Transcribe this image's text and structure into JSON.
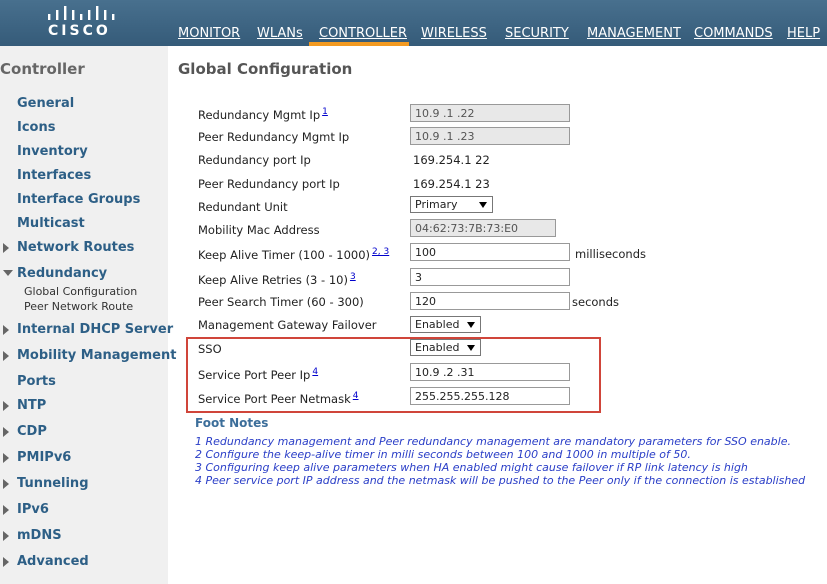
{
  "brand": {
    "logo_text": "CISCO"
  },
  "nav": {
    "items": [
      "MONITOR",
      "WLANs",
      "CONTROLLER",
      "WIRELESS",
      "SECURITY",
      "MANAGEMENT",
      "COMMANDS",
      "HELP"
    ],
    "active": "CONTROLLER",
    "accent_color": "#f39a21"
  },
  "sidebar": {
    "title": "Controller",
    "items": [
      {
        "label": "General",
        "arrow": "none"
      },
      {
        "label": "Icons",
        "arrow": "none"
      },
      {
        "label": "Inventory",
        "arrow": "none"
      },
      {
        "label": "Interfaces",
        "arrow": "none"
      },
      {
        "label": "Interface Groups",
        "arrow": "none"
      },
      {
        "label": "Multicast",
        "arrow": "none"
      },
      {
        "label": "Network Routes",
        "arrow": "right"
      },
      {
        "label": "Redundancy",
        "arrow": "down"
      },
      {
        "label": "Internal DHCP Server",
        "arrow": "right"
      },
      {
        "label": "Mobility Management",
        "arrow": "right"
      },
      {
        "label": "Ports",
        "arrow": "none"
      },
      {
        "label": "NTP",
        "arrow": "right"
      },
      {
        "label": "CDP",
        "arrow": "right"
      },
      {
        "label": "PMIPv6",
        "arrow": "right"
      },
      {
        "label": "Tunneling",
        "arrow": "right"
      },
      {
        "label": "IPv6",
        "arrow": "right"
      },
      {
        "label": "mDNS",
        "arrow": "right"
      },
      {
        "label": "Advanced",
        "arrow": "right"
      }
    ],
    "redundancy_sub": [
      "Global Configuration",
      "Peer Network Route"
    ]
  },
  "page": {
    "title": "Global Configuration",
    "rows": [
      {
        "label": "Redundancy Mgmt Ip",
        "note": "1",
        "value": "10.9  .1  .22",
        "kind": "disabled"
      },
      {
        "label": "Peer Redundancy Mgmt Ip",
        "note": "",
        "value": "10.9  .1  .23",
        "kind": "disabled"
      },
      {
        "label": "Redundancy port Ip",
        "note": "",
        "value": "169.254.1   22",
        "kind": "plain"
      },
      {
        "label": "Peer Redundancy port Ip",
        "note": "",
        "value": "169.254.1   23",
        "kind": "plain"
      },
      {
        "label": "Redundant Unit",
        "note": "",
        "value": "Primary",
        "kind": "select"
      },
      {
        "label": "Mobility Mac Address",
        "note": "",
        "value": "04:62:73:7B:73:E0",
        "kind": "disabled"
      },
      {
        "label": "Keep Alive Timer (100 - 1000)",
        "note": "2, 3",
        "value": "100",
        "kind": "input",
        "unit": "milliseconds"
      },
      {
        "label": "Keep Alive Retries (3 - 10)",
        "note": "3",
        "value": "3",
        "kind": "input"
      },
      {
        "label": "Peer Search Timer (60 - 300)",
        "note": "",
        "value": "120",
        "kind": "input",
        "unit": "seconds"
      },
      {
        "label": "Management Gateway Failover",
        "note": "",
        "value": "Enabled",
        "kind": "select"
      },
      {
        "label": "SSO",
        "note": "",
        "value": "Enabled",
        "kind": "select"
      },
      {
        "label": "Service Port Peer Ip",
        "note": "4",
        "value": "10.9  .2   .31",
        "kind": "input"
      },
      {
        "label": "Service Port Peer Netmask",
        "note": "4",
        "value": "255.255.255.128",
        "kind": "input"
      }
    ],
    "footnotes_title": "Foot Notes",
    "footnotes": [
      "1 Redundancy management and Peer redundancy management are mandatory parameters for SSO enable.",
      "2 Configure the keep-alive timer in milli seconds between 100 and 1000 in multiple of 50.",
      "3 Configuring keep alive parameters when HA enabled might cause failover if RP link latency is high",
      "4 Peer service port IP address and the netmask will be pushed to the Peer only if the connection is established"
    ],
    "highlight_color": "#d0453a"
  }
}
